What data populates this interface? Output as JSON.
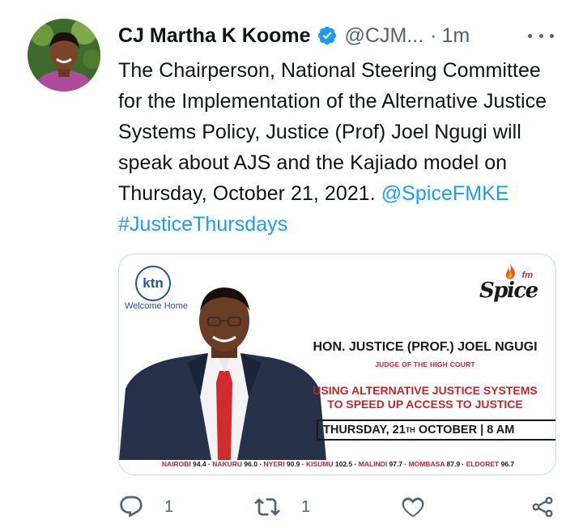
{
  "tweet": {
    "author": {
      "name": "CJ Martha K Koome",
      "handle": "@CJM...",
      "verified": true,
      "avatar_icon": "profile-photo"
    },
    "separator": "·",
    "time": "1m",
    "text_plain": "The Chairperson, National Steering Committee for the Implementation of the Alternative Justice Systems Policy, Justice (Prof) Joel Ngugi will speak about AJS and the Kajiado model on Thursday, October 21, 2021.",
    "mention": "@SpiceFMKE",
    "hashtag": "#JusticeThursdays",
    "media": {
      "ktn_logo": "ktn",
      "ktn_tagline": "Welcome Home",
      "spice_logo": "Spice",
      "spice_fm": "fm",
      "guest_name": "HON. JUSTICE (PROF.) JOEL NGUGI",
      "guest_title": "JUDGE OF THE HIGH COURT",
      "topic_line1": "USING ALTERNATIVE JUSTICE SYSTEMS",
      "topic_line2": "TO SPEED UP ACCESS TO JUSTICE",
      "schedule_day": "THURSDAY, 21",
      "schedule_sup": "TH",
      "schedule_rest": " OCTOBER | 8 AM",
      "stations": [
        {
          "city": "NAIROBI",
          "freq": "94.4"
        },
        {
          "city": "NAKURU",
          "freq": "96.0"
        },
        {
          "city": "NYERI",
          "freq": "90.9"
        },
        {
          "city": "KISUMU",
          "freq": "102.5"
        },
        {
          "city": "MALINDI",
          "freq": "97.7"
        },
        {
          "city": "MOMBASA",
          "freq": "87.9"
        },
        {
          "city": "ELDORET",
          "freq": "96.7"
        }
      ]
    },
    "actions": {
      "reply_count": "1",
      "retweet_count": "1",
      "like_count": "",
      "icons": [
        "reply-icon",
        "retweet-icon",
        "like-icon",
        "share-icon"
      ]
    },
    "colors": {
      "link": "#1d9bf0",
      "secondary_text": "#536471",
      "verified": "#1d9bf0",
      "poster_red": "#c0272d"
    }
  }
}
